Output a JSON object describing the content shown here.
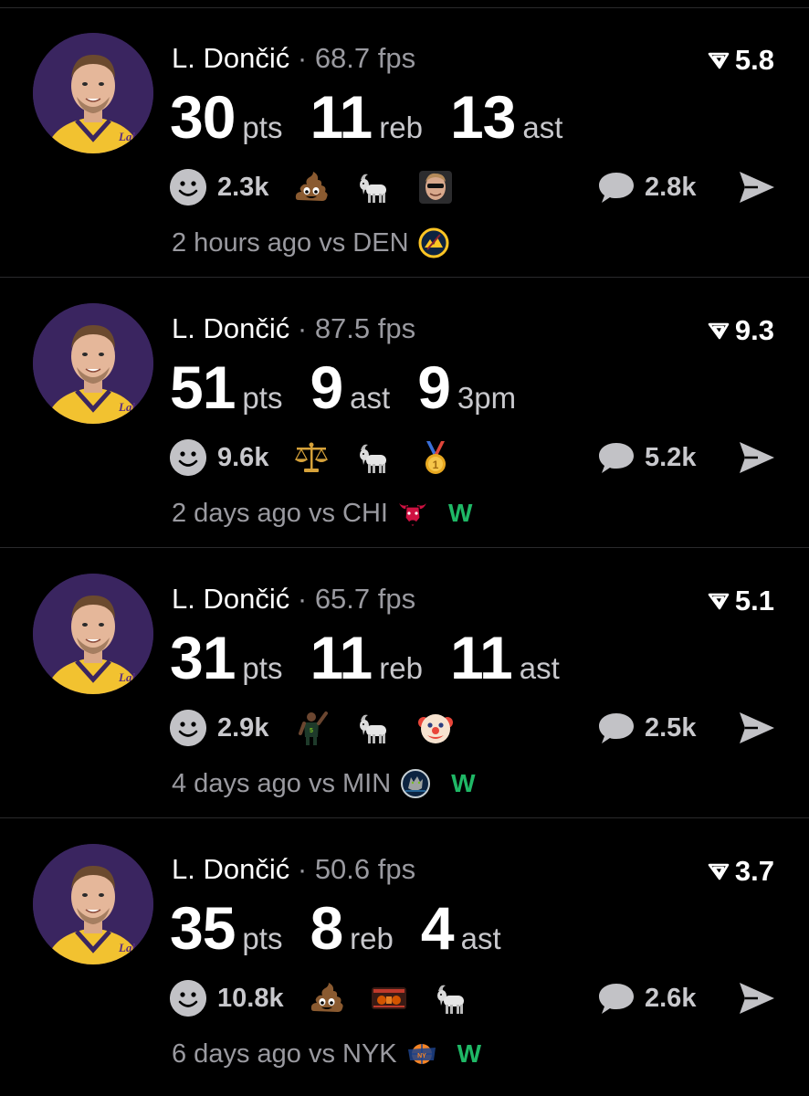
{
  "colors": {
    "background": "#000000",
    "divider": "#2a2a2c",
    "muted_text": "#9a9aa0",
    "win_green": "#1fb866",
    "lakers_purple": "#3a2560",
    "lakers_gold": "#f2c230"
  },
  "posts": [
    {
      "player": "L. Dončić",
      "separator": "·",
      "fps": "68.7 fps",
      "rating": "5.8",
      "stats": [
        {
          "value": "30",
          "unit": "pts"
        },
        {
          "value": "11",
          "unit": "reb"
        },
        {
          "value": "13",
          "unit": "ast"
        }
      ],
      "smiley_count": "2.3k",
      "reactions": [
        "poop-emoji",
        "goat-emoji",
        "player-face-emoji"
      ],
      "comment_count": "2.8k",
      "time_opponent": "2 hours ago vs DEN",
      "opponent_logo": "nuggets-logo",
      "result": ""
    },
    {
      "player": "L. Dončić",
      "separator": "·",
      "fps": "87.5 fps",
      "rating": "9.3",
      "stats": [
        {
          "value": "51",
          "unit": "pts"
        },
        {
          "value": "9",
          "unit": "ast"
        },
        {
          "value": "9",
          "unit": "3pm"
        }
      ],
      "smiley_count": "9.6k",
      "reactions": [
        "scales-emoji",
        "goat-emoji",
        "gold-medal-emoji"
      ],
      "comment_count": "5.2k",
      "time_opponent": "2 days ago vs CHI",
      "opponent_logo": "bulls-logo",
      "result": "W"
    },
    {
      "player": "L. Dončić",
      "separator": "·",
      "fps": "65.7 fps",
      "rating": "5.1",
      "stats": [
        {
          "value": "31",
          "unit": "pts"
        },
        {
          "value": "11",
          "unit": "reb"
        },
        {
          "value": "11",
          "unit": "ast"
        }
      ],
      "smiley_count": "2.9k",
      "reactions": [
        "player-celebration-emoji",
        "goat-emoji",
        "clown-emoji"
      ],
      "comment_count": "2.5k",
      "time_opponent": "4 days ago vs MIN",
      "opponent_logo": "timberwolves-logo",
      "result": "W"
    },
    {
      "player": "L. Dončić",
      "separator": "·",
      "fps": "50.6 fps",
      "rating": "3.7",
      "stats": [
        {
          "value": "35",
          "unit": "pts"
        },
        {
          "value": "8",
          "unit": "reb"
        },
        {
          "value": "4",
          "unit": "ast"
        }
      ],
      "smiley_count": "10.8k",
      "reactions": [
        "poop-emoji",
        "custom-sticker-emoji",
        "goat-emoji"
      ],
      "comment_count": "2.6k",
      "time_opponent": "6 days ago vs NYK",
      "opponent_logo": "knicks-logo",
      "result": "W"
    }
  ]
}
